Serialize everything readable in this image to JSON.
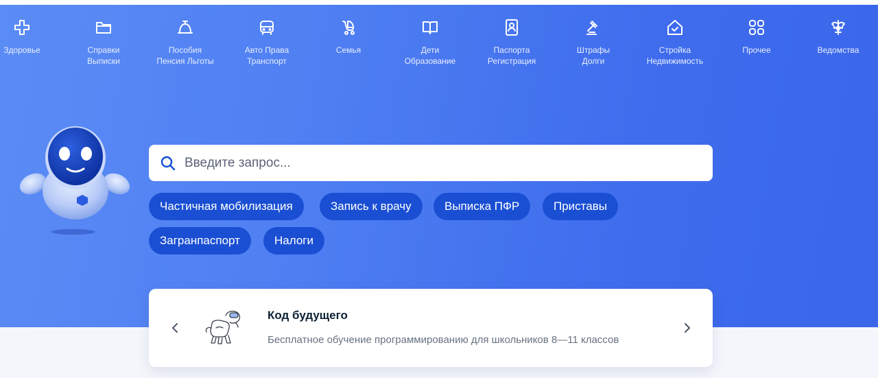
{
  "categories": [
    {
      "icon": "plus-icon",
      "label": "Здоровье"
    },
    {
      "icon": "folder-icon",
      "label": "Справки\nВыписки"
    },
    {
      "icon": "bell-icon",
      "label": "Пособия\nПенсия Льготы"
    },
    {
      "icon": "car-icon",
      "label": "Авто Права\nТранспорт"
    },
    {
      "icon": "stroller-icon",
      "label": "Семья"
    },
    {
      "icon": "book-icon",
      "label": "Дети\nОбразование"
    },
    {
      "icon": "passport-icon",
      "label": "Паспорта\nРегистрация"
    },
    {
      "icon": "gavel-icon",
      "label": "Штрафы\nДолги"
    },
    {
      "icon": "house-icon",
      "label": "Стройка\nНедвижимость"
    },
    {
      "icon": "grid-icon",
      "label": "Прочее"
    },
    {
      "icon": "emblem-icon",
      "label": "Ведомства"
    }
  ],
  "search": {
    "placeholder": "Введите запрос..."
  },
  "chips": [
    "Частичная мобилизация",
    "Запись к врачу",
    "Выписка ПФР",
    "Приставы",
    "Загранпаспорт",
    "Налоги"
  ],
  "promo": {
    "title": "Код будущего",
    "subtitle": "Бесплатное обучение программированию для школьников 8—11 классов"
  },
  "colors": {
    "hero": "#4f7ff2",
    "chip": "#1a4fd4",
    "accent": "#0d4cd3"
  }
}
